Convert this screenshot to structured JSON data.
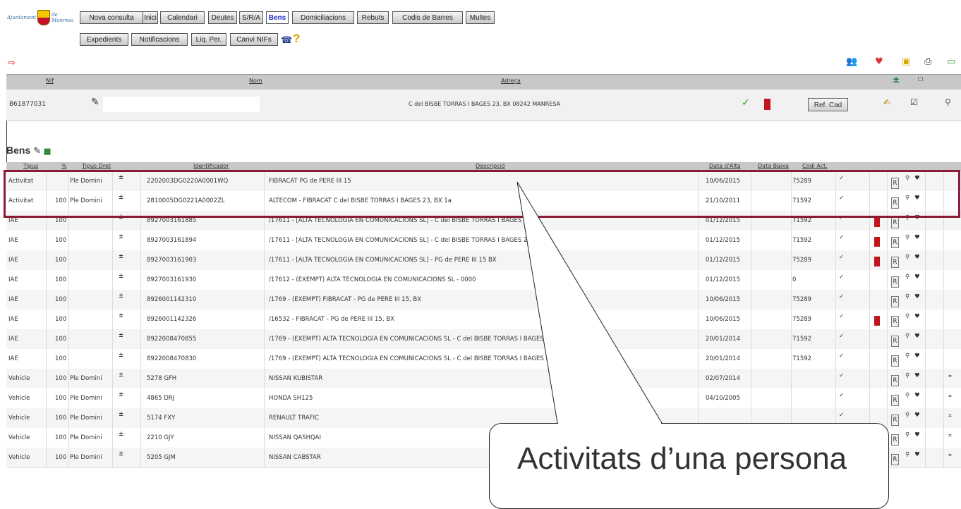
{
  "app": {
    "logo_text_left": "Ajuntament",
    "logo_text_right": "de Manresa"
  },
  "nav": {
    "row1": [
      "Nova consulta",
      "Inici",
      "Calendari",
      "Deutes",
      "S/R/A",
      "Bens",
      "Domiciliacions",
      "Rebuts",
      "Codis de Barres",
      "Multes"
    ],
    "row2": [
      "Expedients",
      "Notificacions",
      "Liq. Per.",
      "Canvi NIFs"
    ],
    "active": "Bens"
  },
  "person": {
    "headers": {
      "nif": "Nif",
      "nom": "Nom",
      "adreca": "Adreça"
    },
    "nif": "B61877031",
    "adreca": "C del BISBE TORRAS I BAGES 23, BX 08242 MANRESA",
    "refcad_label": "Ref. Cad"
  },
  "bens": {
    "title": "Bens",
    "columns": {
      "tipus": "Tipus",
      "pct": "%",
      "dret": "Tipus Dret",
      "id": "Identificador",
      "desc": "Descripció",
      "alta": "Data d'Alta",
      "baixa": "Data Baixa",
      "codi": "Codi Act."
    },
    "rows": [
      {
        "tipus": "Activitat",
        "pct": "",
        "dret": "Ple Domini",
        "id": "2202003DG0220A0001WQ",
        "desc": "FIBRACAT PG de PERE III 15",
        "alta": "10/06/2015",
        "codi": "75289",
        "red": false,
        "att": false
      },
      {
        "tipus": "Activitat",
        "pct": "100",
        "dret": "Ple Domini",
        "id": "2810005DG0221A0002ZL",
        "desc": "ALTECOM - FIBRACAT C del BISBE TORRAS I BAGES 23, BX 1a",
        "alta": "21/10/2011",
        "codi": "71592",
        "red": false,
        "att": false
      },
      {
        "tipus": "IAE",
        "pct": "100",
        "dret": "",
        "id": "8927003161885",
        "desc": "/17611 - [ALTA TECNOLOGIA EN COMUNICACIONS SL] - C del BISBE TORRAS I BAGES",
        "alta": "01/12/2015",
        "codi": "71592",
        "red": true,
        "att": false
      },
      {
        "tipus": "IAE",
        "pct": "100",
        "dret": "",
        "id": "8927003161894",
        "desc": "/17611 - [ALTA TECNOLOGIA EN COMUNICACIONS SL] - C del BISBE TORRAS I BAGES 2",
        "alta": "01/12/2015",
        "codi": "71592",
        "red": true,
        "att": false
      },
      {
        "tipus": "IAE",
        "pct": "100",
        "dret": "",
        "id": "8927003161903",
        "desc": "/17611 - [ALTA TECNOLOGIA EN COMUNICACIONS SL] - PG de PERE III 15 BX",
        "alta": "01/12/2015",
        "codi": "75289",
        "red": true,
        "att": false
      },
      {
        "tipus": "IAE",
        "pct": "100",
        "dret": "",
        "id": "8927003161930",
        "desc": "/17612 - (EXEMPT) ALTA TECNOLOGIA EN COMUNICACIONS SL - 0000",
        "alta": "01/12/2015",
        "codi": "0",
        "red": false,
        "att": false
      },
      {
        "tipus": "IAE",
        "pct": "100",
        "dret": "",
        "id": "8926001142310",
        "desc": "/1769 - (EXEMPT) FIBRACAT - PG de PERE III 15, BX",
        "alta": "10/06/2015",
        "codi": "75289",
        "red": false,
        "att": false
      },
      {
        "tipus": "IAE",
        "pct": "100",
        "dret": "",
        "id": "8926001142326",
        "desc": "/16532 - FIBRACAT - PG de PERE III 15, BX",
        "alta": "10/06/2015",
        "codi": "75289",
        "red": true,
        "att": false
      },
      {
        "tipus": "IAE",
        "pct": "100",
        "dret": "",
        "id": "8922008470855",
        "desc": "/1769 - (EXEMPT) ALTA TECNOLOGIA EN COMUNICACIONS SL - C del BISBE TORRAS I BAGES",
        "alta": "20/01/2014",
        "codi": "71592",
        "red": false,
        "att": false
      },
      {
        "tipus": "IAE",
        "pct": "100",
        "dret": "",
        "id": "8922008470830",
        "desc": "/1769 - (EXEMPT) ALTA TECNOLOGIA EN COMUNICACIONS SL - C del BISBE TORRAS I BAGES 2",
        "alta": "20/01/2014",
        "codi": "71592",
        "red": false,
        "att": false
      },
      {
        "tipus": "Vehicle",
        "pct": "100",
        "dret": "Ple Domini",
        "id": "5278 GFH",
        "desc": "NISSAN KUBISTAR",
        "alta": "02/07/2014",
        "codi": "",
        "red": false,
        "att": true
      },
      {
        "tipus": "Vehicle",
        "pct": "100",
        "dret": "Ple Domini",
        "id": "4865 DRJ",
        "desc": "HONDA SH125",
        "alta": "04/10/2005",
        "codi": "",
        "red": false,
        "att": true
      },
      {
        "tipus": "Vehicle",
        "pct": "100",
        "dret": "Ple Domini",
        "id": "5174 FXY",
        "desc": "RENAULT TRAFIC",
        "alta": "",
        "codi": "",
        "red": false,
        "att": true
      },
      {
        "tipus": "Vehicle",
        "pct": "100",
        "dret": "Ple Domini",
        "id": "2210 GJY",
        "desc": "NISSAN QASHQAI",
        "alta": "",
        "codi": "",
        "red": false,
        "att": true
      },
      {
        "tipus": "Vehicle",
        "pct": "100",
        "dret": "Ple Domini",
        "id": "5205 GJM",
        "desc": "NISSAN CABSTAR",
        "alta": "",
        "codi": "",
        "red": false,
        "att": true
      }
    ]
  },
  "callout": {
    "text": "Activitats d’una persona"
  },
  "colors": {
    "highlight": "#8b1b35",
    "check": "#2e9a2e",
    "red": "#c0141e",
    "active_tab": "#1c2bc9"
  }
}
